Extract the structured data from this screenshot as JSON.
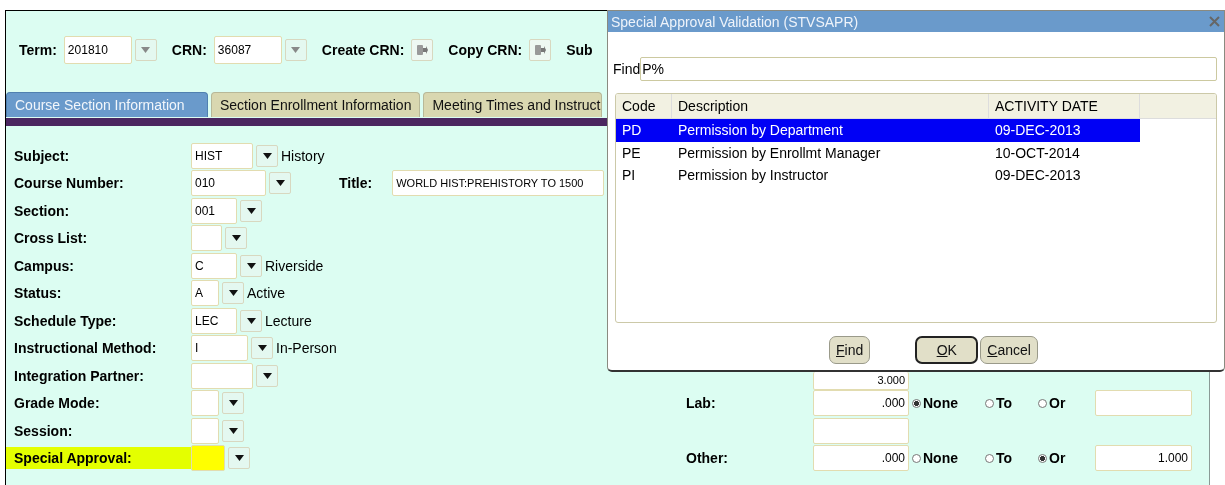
{
  "header": {
    "fields": [
      {
        "kind": "select",
        "label": "Term:",
        "value": "201810"
      },
      {
        "kind": "select",
        "label": "CRN:",
        "value": "36087"
      },
      {
        "kind": "action",
        "label": "Create CRN:"
      },
      {
        "kind": "action",
        "label": "Copy CRN:"
      },
      {
        "kind": "label",
        "label": "Sub"
      }
    ]
  },
  "tabs": [
    {
      "label": "Course Section Information",
      "selected": true
    },
    {
      "label": "Section Enrollment Information",
      "selected": false
    },
    {
      "label": "Meeting Times and Instruct",
      "selected": false
    }
  ],
  "form": {
    "rows": [
      {
        "label": "Subject:",
        "value": "HIST",
        "description": "History",
        "highlighted": false
      },
      {
        "label": "Course Number:",
        "value": "010",
        "title_label": "Title:",
        "title_value": "WORLD HIST:PREHISTORY TO 1500",
        "highlighted": false
      },
      {
        "label": "Section:",
        "value": "001",
        "highlighted": false
      },
      {
        "label": "Cross List:",
        "highlighted": false
      },
      {
        "label": "Campus:",
        "value": "C",
        "description": "Riverside",
        "highlighted": false
      },
      {
        "label": "Status:",
        "value": "A",
        "description": "Active",
        "highlighted": false
      },
      {
        "label": "Schedule Type:",
        "value": "LEC",
        "description": "Lecture",
        "highlighted": false
      },
      {
        "label": "Instructional Method:",
        "value": "I",
        "description": "In-Person",
        "highlighted": false
      },
      {
        "label": "Integration Partner:",
        "highlighted": false,
        "right": {
          "kind": "field",
          "value": "3.000"
        }
      },
      {
        "label": "Grade Mode:",
        "highlighted": false,
        "right": {
          "kind": "hours",
          "label": "Lab:",
          "value": ".000",
          "options": [
            {
              "label": "None",
              "selected": true
            },
            {
              "label": "To",
              "selected": false
            },
            {
              "label": "Or",
              "selected": false
            }
          ]
        }
      },
      {
        "label": "Session:",
        "highlighted": false,
        "right": {
          "kind": "field"
        }
      },
      {
        "label": "Special Approval:",
        "highlighted": true,
        "right": {
          "kind": "hours",
          "label": "Other:",
          "value": ".000",
          "options": [
            {
              "label": "None",
              "selected": false
            },
            {
              "label": "To",
              "selected": false
            },
            {
              "label": "Or",
              "selected": true
            }
          ],
          "extra": "1.000"
        }
      }
    ]
  },
  "dialog": {
    "title": "Special Approval Validation (STVSAPR)",
    "find_label": "Find",
    "find_value": "P%",
    "columns": [
      "Code",
      "Description",
      "ACTIVITY DATE"
    ],
    "rows": [
      {
        "cells": [
          "PD",
          "Permission by Department",
          "09-DEC-2013"
        ],
        "selected": true
      },
      {
        "cells": [
          "PE",
          "Permission by Enrollmt Manager",
          "10-OCT-2014"
        ],
        "selected": false
      },
      {
        "cells": [
          "PI",
          "Permission by Instructor",
          "09-DEC-2013"
        ],
        "selected": false
      }
    ],
    "buttons": [
      {
        "label": "Find",
        "default": false
      },
      {
        "label": "OK",
        "default": true
      },
      {
        "label": "Cancel",
        "default": false
      }
    ]
  }
}
